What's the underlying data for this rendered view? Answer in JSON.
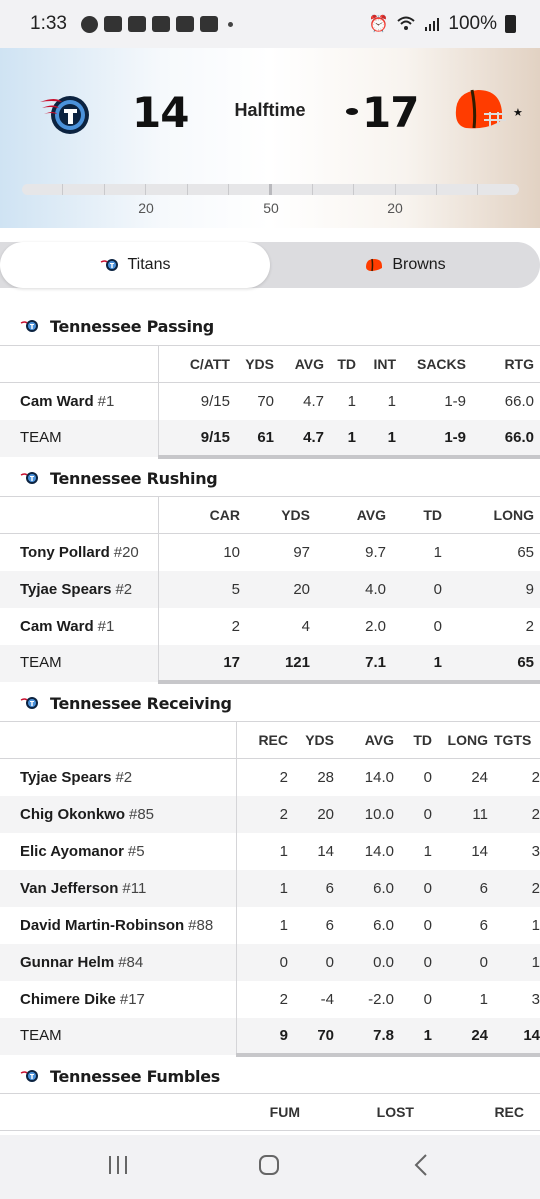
{
  "status_bar": {
    "time": "1:33",
    "battery": "100%"
  },
  "game": {
    "home_score": "14",
    "away_score": "17",
    "status": "Halftime",
    "field_labels": [
      "20",
      "50",
      "20"
    ]
  },
  "colors": {
    "titans_navy": "#0c2340",
    "titans_blue": "#4b92db",
    "browns_orange": "#ff3c00",
    "browns_brown": "#311d00"
  },
  "toggle": {
    "home": "Titans",
    "away": "Browns"
  },
  "passing": {
    "title": "Tennessee Passing",
    "headers": [
      "C/ATT",
      "YDS",
      "AVG",
      "TD",
      "INT",
      "SACKS",
      "RTG"
    ],
    "rows": [
      {
        "name": "Cam Ward",
        "num": "#1",
        "cells": [
          "9/15",
          "70",
          "4.7",
          "1",
          "1",
          "1-9",
          "66.0"
        ]
      }
    ],
    "team": {
      "name": "TEAM",
      "cells": [
        "9/15",
        "61",
        "4.7",
        "1",
        "1",
        "1-9",
        "66.0"
      ]
    }
  },
  "rushing": {
    "title": "Tennessee Rushing",
    "headers": [
      "CAR",
      "YDS",
      "AVG",
      "TD",
      "LONG"
    ],
    "rows": [
      {
        "name": "Tony Pollard",
        "num": "#20",
        "cells": [
          "10",
          "97",
          "9.7",
          "1",
          "65"
        ]
      },
      {
        "name": "Tyjae Spears",
        "num": "#2",
        "cells": [
          "5",
          "20",
          "4.0",
          "0",
          "9"
        ]
      },
      {
        "name": "Cam Ward",
        "num": "#1",
        "cells": [
          "2",
          "4",
          "2.0",
          "0",
          "2"
        ]
      }
    ],
    "team": {
      "name": "TEAM",
      "cells": [
        "17",
        "121",
        "7.1",
        "1",
        "65"
      ]
    }
  },
  "receiving": {
    "title": "Tennessee Receiving",
    "headers": [
      "REC",
      "YDS",
      "AVG",
      "TD",
      "LONG",
      "TGTS"
    ],
    "rows": [
      {
        "name": "Tyjae Spears",
        "num": "#2",
        "cells": [
          "2",
          "28",
          "14.0",
          "0",
          "24",
          "2"
        ]
      },
      {
        "name": "Chig Okonkwo",
        "num": "#85",
        "cells": [
          "2",
          "20",
          "10.0",
          "0",
          "11",
          "2"
        ]
      },
      {
        "name": "Elic Ayomanor",
        "num": "#5",
        "cells": [
          "1",
          "14",
          "14.0",
          "1",
          "14",
          "3"
        ]
      },
      {
        "name": "Van Jefferson",
        "num": "#11",
        "cells": [
          "1",
          "6",
          "6.0",
          "0",
          "6",
          "2"
        ]
      },
      {
        "name": "David Martin-Robinson",
        "num": "#88",
        "cells": [
          "1",
          "6",
          "6.0",
          "0",
          "6",
          "1"
        ]
      },
      {
        "name": "Gunnar Helm",
        "num": "#84",
        "cells": [
          "0",
          "0",
          "0.0",
          "0",
          "0",
          "1"
        ]
      },
      {
        "name": "Chimere Dike",
        "num": "#17",
        "cells": [
          "2",
          "-4",
          "-2.0",
          "0",
          "1",
          "3"
        ]
      }
    ],
    "team": {
      "name": "TEAM",
      "cells": [
        "9",
        "70",
        "7.8",
        "1",
        "24",
        "14"
      ]
    }
  },
  "fumbles": {
    "title": "Tennessee Fumbles",
    "headers": [
      "FUM",
      "LOST",
      "REC"
    ]
  }
}
